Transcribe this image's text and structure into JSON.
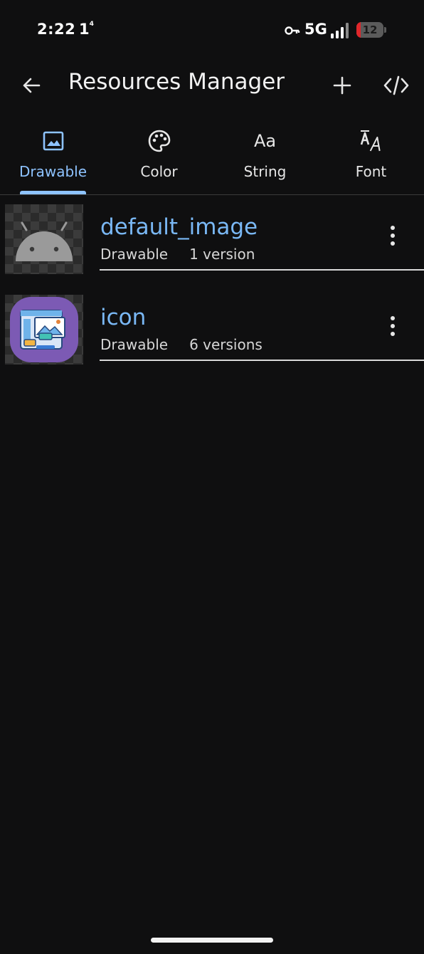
{
  "status_bar": {
    "time": "2:22",
    "notification": "1",
    "notification_sup": "4",
    "network": "5G",
    "battery_level": "12",
    "icons": [
      "key-icon",
      "signal-icon",
      "battery-icon"
    ]
  },
  "app_bar": {
    "title": "Resources Manager",
    "back_icon": "arrow-left-icon",
    "add_icon": "plus-icon",
    "code_icon": "code-icon"
  },
  "tabs": [
    {
      "label": "Drawable",
      "icon": "image-icon",
      "active": true
    },
    {
      "label": "Color",
      "icon": "palette-icon",
      "active": false
    },
    {
      "label": "String",
      "icon": "text-aa-icon",
      "active": false
    },
    {
      "label": "Font",
      "icon": "font-icon",
      "active": false
    }
  ],
  "tab_icon_text": {
    "string": "Aa"
  },
  "resources": [
    {
      "name": "default_image",
      "type": "Drawable",
      "versions": "1 version",
      "thumbnail": "android-icon"
    },
    {
      "name": "icon",
      "type": "Drawable",
      "versions": "6 versions",
      "thumbnail": "app-builder-icon"
    }
  ],
  "colors": {
    "background": "#0f0f10",
    "accent": "#8ec3ff",
    "resource_name": "#7ab8f5",
    "battery_low": "#e0272b",
    "icon_purple": "#7c5ab4"
  }
}
